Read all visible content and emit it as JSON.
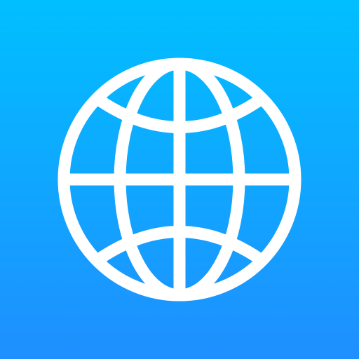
{
  "app_icon": {
    "icon": "globe-icon",
    "colors": {
      "gradient_top": "#00BFFF",
      "gradient_bottom": "#1F8FFF",
      "glyph": "#FFFFFF"
    }
  }
}
